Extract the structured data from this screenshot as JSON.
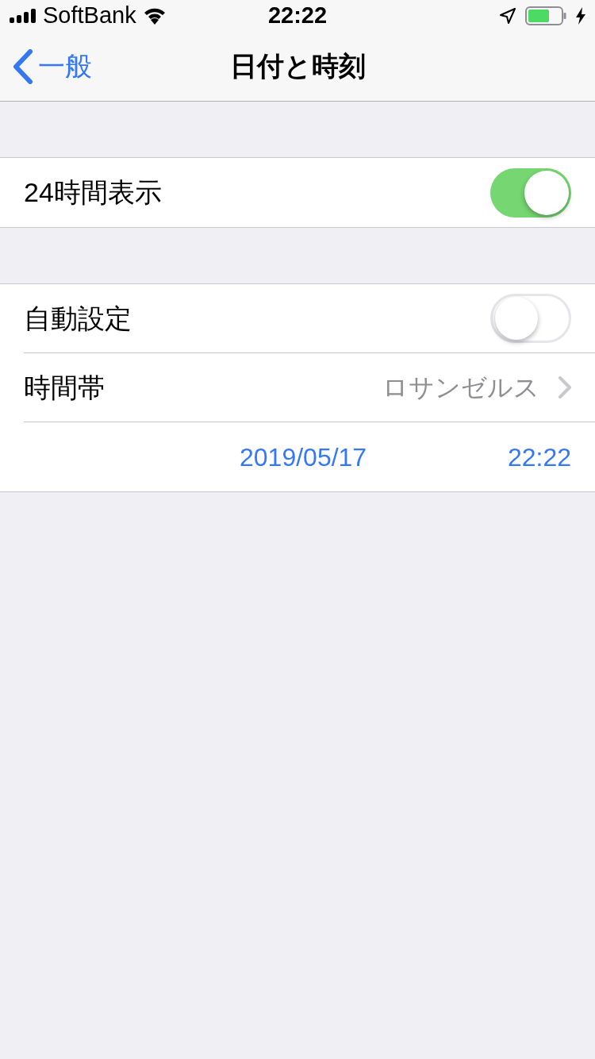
{
  "status_bar": {
    "carrier": "SoftBank",
    "time": "22:22"
  },
  "nav": {
    "back": "一般",
    "title": "日付と時刻"
  },
  "sections": [
    {
      "rows": [
        {
          "kind": "toggle",
          "label": "24時間表示",
          "on": true
        }
      ]
    },
    {
      "rows": [
        {
          "kind": "toggle",
          "label": "自動設定",
          "on": false
        },
        {
          "kind": "link",
          "label": "時間帯",
          "value": "ロサンゼルス"
        },
        {
          "kind": "datetime",
          "date": "2019/05/17",
          "time": "22:22"
        }
      ]
    }
  ]
}
